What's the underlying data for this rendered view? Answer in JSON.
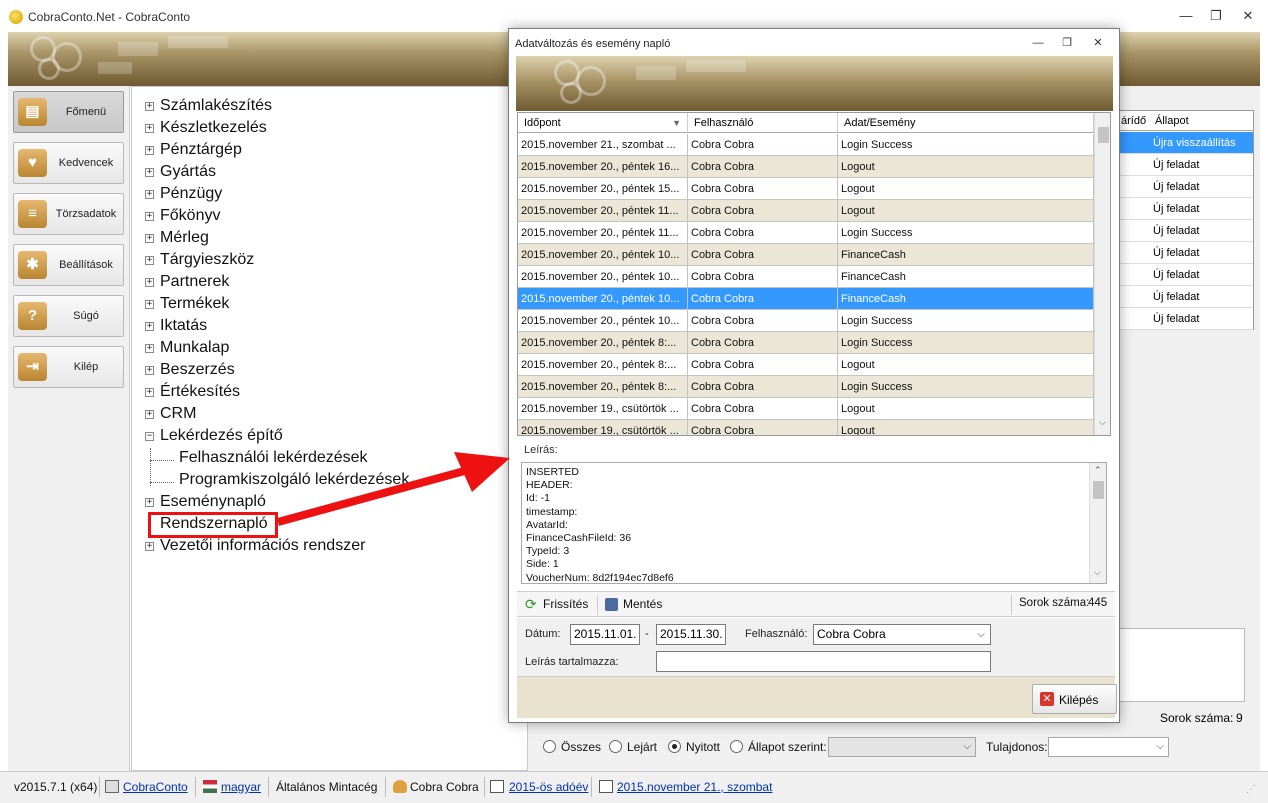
{
  "window": {
    "title": "CobraConto.Net - CobraConto",
    "controls": {
      "minimize": "—",
      "restore": "❐",
      "close": "✕"
    }
  },
  "leftnav": {
    "items": [
      {
        "label": "Főmenü",
        "icon": "tree-icon",
        "glyph": "▤"
      },
      {
        "label": "Kedvencek",
        "icon": "heart-icon",
        "glyph": "♥"
      },
      {
        "label": "Törzsadatok",
        "icon": "document-icon",
        "glyph": "≡"
      },
      {
        "label": "Beállítások",
        "icon": "gear-icon",
        "glyph": "✱"
      },
      {
        "label": "Súgó",
        "icon": "help-icon",
        "glyph": "?"
      },
      {
        "label": "Kilép",
        "icon": "exit-icon",
        "glyph": "⇥"
      }
    ]
  },
  "tree": {
    "items": [
      {
        "label": "Számlakészítés",
        "expander": "+"
      },
      {
        "label": "Készletkezelés",
        "expander": "+"
      },
      {
        "label": "Pénztárgép",
        "expander": "+"
      },
      {
        "label": "Gyártás",
        "expander": "+"
      },
      {
        "label": "Pénzügy",
        "expander": "+"
      },
      {
        "label": "Főkönyv",
        "expander": "+"
      },
      {
        "label": "Mérleg",
        "expander": "+"
      },
      {
        "label": "Tárgyieszköz",
        "expander": "+"
      },
      {
        "label": "Partnerek",
        "expander": "+"
      },
      {
        "label": "Termékek",
        "expander": "+"
      },
      {
        "label": "Iktatás",
        "expander": "+"
      },
      {
        "label": "Munkalap",
        "expander": "+"
      },
      {
        "label": "Beszerzés",
        "expander": "+"
      },
      {
        "label": "Értékesítés",
        "expander": "+"
      },
      {
        "label": "CRM",
        "expander": "+"
      },
      {
        "label": "Lekérdezés építő",
        "expander": "−"
      },
      {
        "label": "Felhasználói lekérdezések",
        "expander": ""
      },
      {
        "label": "Programkiszolgáló lekérdezések",
        "expander": ""
      },
      {
        "label": "Eseménynapló",
        "expander": "+"
      },
      {
        "label": "Rendszernapló",
        "expander": ""
      },
      {
        "label": "Vezetői információs rendszer",
        "expander": "+"
      }
    ]
  },
  "background_grid": {
    "header_partial": "árídő",
    "header_status": "Állapot",
    "rows": [
      "Újra visszaállítás",
      "Új feladat",
      "Új feladat",
      "Új feladat",
      "Új feladat",
      "Új feladat",
      "Új feladat",
      "Új feladat",
      "Új feladat"
    ],
    "row_count_label": "Sorok száma:",
    "row_count": "9"
  },
  "background_filter": {
    "radios": [
      {
        "label": "Összes",
        "checked": false
      },
      {
        "label": "Lejárt",
        "checked": false
      },
      {
        "label": "Nyitott",
        "checked": true
      },
      {
        "label": "Állapot szerint:",
        "checked": false
      }
    ],
    "owner_label": "Tulajdonos:",
    "status_value": "",
    "owner_value": ""
  },
  "dialog": {
    "title": "Adatváltozás és esemény napló",
    "grid": {
      "columns": [
        "Időpont",
        "Felhasználó",
        "Adat/Esemény"
      ],
      "rows": [
        [
          "2015.november 21., szombat ...",
          "Cobra Cobra",
          "Login Success"
        ],
        [
          "2015.november 20., péntek 16...",
          "Cobra Cobra",
          "Logout"
        ],
        [
          "2015.november 20., péntek 15...",
          "Cobra Cobra",
          "Logout"
        ],
        [
          "2015.november 20., péntek 11...",
          "Cobra Cobra",
          "Logout"
        ],
        [
          "2015.november 20., péntek 11...",
          "Cobra Cobra",
          "Login Success"
        ],
        [
          "2015.november 20., péntek 10...",
          "Cobra Cobra",
          "FinanceCash"
        ],
        [
          "2015.november 20., péntek 10...",
          "Cobra Cobra",
          "FinanceCash"
        ],
        [
          "2015.november 20., péntek 10...",
          "Cobra Cobra",
          "FinanceCash"
        ],
        [
          "2015.november 20., péntek 10...",
          "Cobra Cobra",
          "Login Success"
        ],
        [
          "2015.november 20., péntek 8:...",
          "Cobra Cobra",
          "Login Success"
        ],
        [
          "2015.november 20., péntek 8:...",
          "Cobra Cobra",
          "Logout"
        ],
        [
          "2015.november 20., péntek 8:...",
          "Cobra Cobra",
          "Login Success"
        ],
        [
          "2015.november 19., csütörtök ...",
          "Cobra Cobra",
          "Logout"
        ],
        [
          "2015.november 19., csütörtök ...",
          "Cobra Cobra",
          "Logout"
        ]
      ],
      "selected_row": 7
    },
    "description_label": "Leírás:",
    "description_lines": [
      "INSERTED",
      "HEADER:",
      "Id: -1",
      "timestamp:",
      "AvatarId:",
      "FinanceCashFileId: 36",
      "TypeId: 3",
      "Side: 1",
      "VoucherNum: 8d2f194ec7d8ef6"
    ],
    "toolbar": {
      "refresh_label": "Frissítés",
      "save_label": "Mentés",
      "row_count_label": "Sorok száma:",
      "row_count": "445"
    },
    "filter": {
      "date_label": "Dátum:",
      "date_from": "2015.11.01.",
      "date_sep": "-",
      "date_to": "2015.11.30.",
      "user_label": "Felhasználó:",
      "user_value": "Cobra Cobra",
      "desc_contains_label": "Leírás tartalmazza:",
      "desc_contains_value": ""
    },
    "exit_label": "Kilépés"
  },
  "statusbar": {
    "version": "v2015.7.1 (x64)",
    "db_link": "CobraConto",
    "language": "magyar",
    "company": "Általános Mintacég",
    "user": "Cobra Cobra",
    "tax_year": "2015-ös adóév",
    "date": "2015.november 21., szombat"
  },
  "colors": {
    "selection": "#3399ff",
    "row_alt": "#ebe6d6",
    "highlight_red": "#ee1111"
  }
}
